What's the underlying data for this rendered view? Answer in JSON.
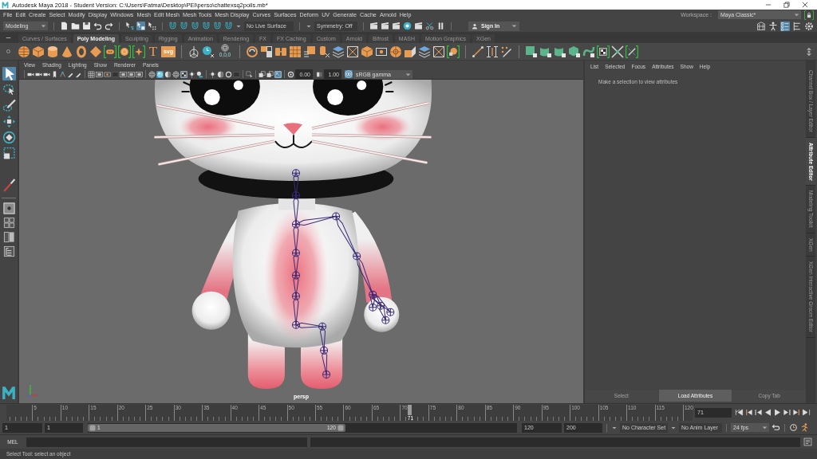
{
  "window": {
    "title": "Autodesk Maya 2018 - Student Version: C:\\Users\\Fatma\\Desktop\\PEI\\perso\\chattexsq2poils.mb*"
  },
  "menu_bar": [
    "File",
    "Edit",
    "Create",
    "Select",
    "Modify",
    "Display",
    "Windows",
    "Mesh",
    "Edit Mesh",
    "Mesh Tools",
    "Mesh Display",
    "Curves",
    "Surfaces",
    "Deform",
    "UV",
    "Generate",
    "Cache",
    "Arnold",
    "Help"
  ],
  "workspace": {
    "label": "Workspace :",
    "value": "Maya Classic*"
  },
  "status_line": {
    "menu_set": "Modeling",
    "tools": [
      [
        {
          "kind": "page",
          "on": false
        },
        {
          "kind": "folder",
          "on": false
        },
        {
          "kind": "disk",
          "on": false
        },
        {
          "kind": "undo",
          "on": false
        },
        {
          "kind": "redo",
          "on": false
        }
      ],
      [
        {
          "kind": "hierarchy",
          "on": false
        },
        {
          "kind": "object",
          "on": true
        },
        {
          "kind": "component",
          "on": false
        }
      ],
      [
        {
          "kind": "magnet",
          "on": false
        },
        {
          "kind": "magnet",
          "on": false
        },
        {
          "kind": "magnet",
          "on": false
        },
        {
          "kind": "magnet",
          "on": false
        },
        {
          "kind": "magnet",
          "on": false
        },
        {
          "kind": "magnet",
          "on": false
        }
      ]
    ],
    "live_surface": "No Live Surface",
    "symmetry": "Symmetry: Off",
    "render_tools": [
      {
        "kind": "clapper"
      },
      {
        "kind": "clapper"
      },
      {
        "kind": "clapper"
      },
      {
        "kind": "rendersphere"
      },
      {
        "kind": "clapper"
      },
      {
        "kind": "scissors"
      },
      {
        "kind": "pause"
      }
    ],
    "sign_in": "Sign In",
    "panel_toggles": [
      {
        "kind": "crate",
        "on": false
      },
      {
        "kind": "person",
        "on": false
      },
      {
        "kind": "list",
        "on": true
      },
      {
        "kind": "channel",
        "on": false
      },
      {
        "kind": "gear",
        "on": false
      }
    ]
  },
  "shelf_tabs": [
    {
      "label": "Curves / Surfaces",
      "selected": false
    },
    {
      "label": "Poly Modeling",
      "selected": true
    },
    {
      "label": "Sculpting",
      "selected": false
    },
    {
      "label": "Rigging",
      "selected": false
    },
    {
      "label": "Animation",
      "selected": false
    },
    {
      "label": "Rendering",
      "selected": false
    },
    {
      "label": "FX",
      "selected": false
    },
    {
      "label": "FX Caching",
      "selected": false
    },
    {
      "label": "Custom",
      "selected": false
    },
    {
      "label": "Arnold",
      "selected": false
    },
    {
      "label": "Bifrost",
      "selected": false
    },
    {
      "label": "MASH",
      "selected": false
    },
    {
      "label": "Motion Graphics",
      "selected": false
    },
    {
      "label": "XGen",
      "selected": false
    }
  ],
  "shelf": [
    [
      {
        "kind": "sphere",
        "framed": false
      },
      {
        "kind": "cube",
        "framed": false
      },
      {
        "kind": "cylinder",
        "framed": false
      },
      {
        "kind": "cone",
        "framed": false
      },
      {
        "kind": "torus",
        "framed": false
      },
      {
        "kind": "diamond",
        "framed": false
      },
      {
        "kind": "capsule",
        "framed": true
      },
      {
        "kind": "orb",
        "framed": true
      },
      {
        "kind": "star",
        "framed": true
      },
      {
        "kind": "glyph",
        "text": "T",
        "framed": false
      },
      {
        "kind": "label",
        "text": "svg",
        "framed": false
      }
    ],
    [
      {
        "kind": "gizmo",
        "framed": false
      },
      {
        "kind": "clock",
        "framed": false
      },
      {
        "kind": "coords",
        "text": "0,0,0",
        "framed": false
      }
    ],
    [
      {
        "kind": "ring",
        "framed": false
      },
      {
        "kind": "squares",
        "framed": false
      },
      {
        "kind": "blocks",
        "framed": false
      },
      {
        "kind": "grid",
        "framed": false
      },
      {
        "kind": "tiles",
        "framed": false
      },
      {
        "kind": "column",
        "framed": false
      },
      {
        "kind": "layers",
        "framed": false
      },
      {
        "kind": "box",
        "framed": false
      },
      {
        "kind": "cube",
        "framed": false
      },
      {
        "kind": "target",
        "framed": false
      },
      {
        "kind": "wheel",
        "framed": false
      },
      {
        "kind": "corner",
        "framed": false
      },
      {
        "kind": "layers",
        "framed": false
      },
      {
        "kind": "box",
        "framed": false
      },
      {
        "kind": "gridball",
        "framed": true
      }
    ],
    [
      {
        "kind": "pen",
        "framed": false
      },
      {
        "kind": "bracket",
        "framed": false
      },
      {
        "kind": "pencil",
        "framed": false
      }
    ],
    [
      {
        "kind": "panel",
        "framed": false
      },
      {
        "kind": "sheet",
        "framed": false
      },
      {
        "kind": "sheet",
        "framed": false
      },
      {
        "kind": "greencube",
        "framed": false
      },
      {
        "kind": "curve",
        "framed": false
      },
      {
        "kind": "checker",
        "framed": true
      },
      {
        "kind": "cross",
        "framed": false
      },
      {
        "kind": "blade",
        "framed": true
      }
    ]
  ],
  "toolbox": [
    {
      "kind": "arrow",
      "selected": true
    },
    {
      "kind": "lasso",
      "selected": false
    },
    {
      "kind": "brushselect",
      "selected": false
    },
    {
      "kind": "move",
      "selected": false
    },
    {
      "kind": "rotate",
      "selected": false
    },
    {
      "kind": "scale",
      "selected": false
    },
    {
      "kind": "paintbrush",
      "selected": false
    }
  ],
  "layouts": [
    {
      "kind": "single",
      "selected": true
    },
    {
      "kind": "quad",
      "selected": false
    },
    {
      "kind": "split",
      "selected": false
    },
    {
      "kind": "outliner",
      "selected": false
    }
  ],
  "viewport": {
    "menus": [
      "View",
      "Shading",
      "Lighting",
      "Show",
      "Renderer",
      "Panels"
    ],
    "toolbar": [
      [
        {
          "kind": "camera",
          "on": false
        },
        {
          "kind": "camera",
          "on": false
        },
        {
          "kind": "camera",
          "on": false
        },
        {
          "kind": "bookmark",
          "on": false
        },
        {
          "kind": "nodes",
          "on": false
        },
        {
          "kind": "brush",
          "on": false
        },
        {
          "kind": "brush",
          "on": false
        }
      ],
      [
        {
          "kind": "gridlines",
          "on": false
        },
        {
          "kind": "frame",
          "on": false
        },
        {
          "kind": "target",
          "on": false
        },
        {
          "kind": "square",
          "on": false
        },
        {
          "kind": "frame",
          "on": false
        },
        {
          "kind": "frame",
          "on": false
        },
        {
          "kind": "frame",
          "on": false
        }
      ],
      [
        {
          "kind": "wiresphere",
          "on": false
        },
        {
          "kind": "shadedsphere",
          "on": true
        },
        {
          "kind": "halfsphere",
          "on": false
        },
        {
          "kind": "wiresphere",
          "on": false
        },
        {
          "kind": "checker",
          "on": true
        },
        {
          "kind": "light",
          "on": false
        },
        {
          "kind": "shadow",
          "on": false
        }
      ],
      [
        {
          "kind": "light",
          "on": false
        },
        {
          "kind": "halfsphere",
          "on": false
        },
        {
          "kind": "ring2",
          "on": false
        },
        {
          "kind": "square",
          "on": false
        }
      ],
      [
        {
          "kind": "selectframe",
          "on": false
        }
      ],
      [
        {
          "kind": "overlap",
          "on": false
        },
        {
          "kind": "overlap",
          "on": false
        },
        {
          "kind": "cursorframe",
          "on": true
        }
      ]
    ],
    "exposure": "0.00",
    "gamma": "1.00",
    "color_managed": true,
    "color_space": "sRGB gamma",
    "camera": "persp"
  },
  "attribute_editor": {
    "menus": [
      "List",
      "Selected",
      "Focus",
      "Attributes",
      "Show",
      "Help"
    ],
    "message": "Make a selection to view attributes",
    "buttons": [
      {
        "label": "Select",
        "disabled": true
      },
      {
        "label": "Load Attributes",
        "disabled": false
      },
      {
        "label": "Copy Tab",
        "disabled": true
      }
    ]
  },
  "side_tabs": [
    {
      "label": "Channel Box / Layer Editor",
      "selected": false
    },
    {
      "label": "Attribute Editor",
      "selected": true
    },
    {
      "label": "Modeling Toolkit",
      "selected": false
    },
    {
      "label": "XGen",
      "selected": false
    },
    {
      "label": "XGen Interactive Groom Editor",
      "selected": false
    }
  ],
  "time_slider": {
    "ticks": [
      "5",
      "10",
      "15",
      "20",
      "25",
      "30",
      "35",
      "40",
      "45",
      "50",
      "55",
      "60",
      "65",
      "70",
      "75",
      "80",
      "85",
      "90",
      "95",
      "100",
      "105",
      "110",
      "115",
      "120"
    ],
    "current_frame": "71",
    "level": 0.588,
    "frame_field": "71"
  },
  "range_slider": {
    "start": "1",
    "playback_start": "1",
    "range_start": "1",
    "range_end": "120",
    "level": 0.6,
    "playback_end": "120",
    "end": "200",
    "character_set": "No Character Set",
    "anim_layer": "No Anim Layer",
    "fps": "24 fps"
  },
  "command_line": {
    "language": "MEL"
  },
  "help_line": "Select Tool: select an object"
}
